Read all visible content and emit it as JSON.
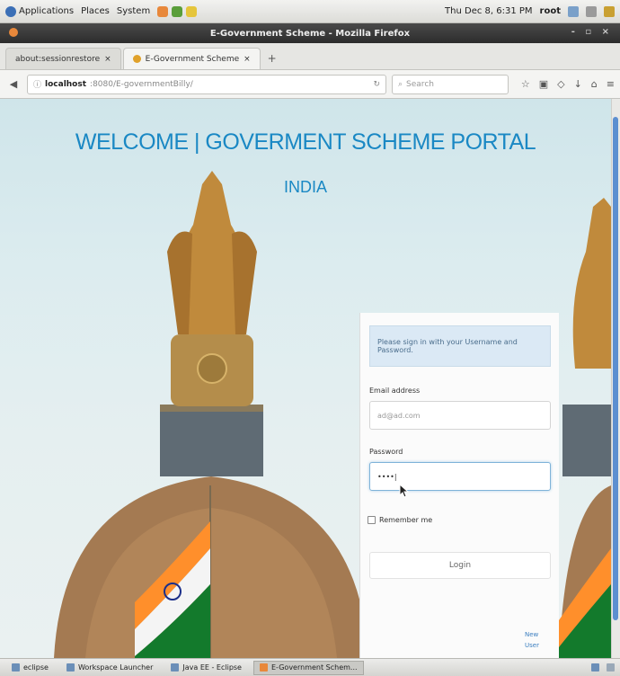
{
  "gnome_panel": {
    "menus": [
      "Applications",
      "Places",
      "System"
    ],
    "clock": "Thu Dec 8, 6:31 PM",
    "user": "root"
  },
  "window": {
    "title": "E-Government Scheme - Mozilla Firefox",
    "controls": "- ▫ ×"
  },
  "tabs": [
    {
      "label": "about:sessionrestore",
      "active": false
    },
    {
      "label": "E-Government Scheme",
      "active": true
    }
  ],
  "navbar": {
    "url_host": "localhost",
    "url_path": ":8080/E-governmentBilly/",
    "search_placeholder": "Search"
  },
  "page": {
    "heading": "WELCOME | GOVERMENT SCHEME PORTAL",
    "country": "INDIA",
    "login": {
      "info_text": "Please sign in with your Username and Password.",
      "email_label": "Email address",
      "email_placeholder": "ad@ad.com",
      "password_label": "Password",
      "password_value": "••••|",
      "remember_label": "Remember me",
      "login_button": "Login",
      "links": [
        "New",
        "User"
      ]
    }
  },
  "taskbar": {
    "items": [
      {
        "label": "eclipse",
        "active": false
      },
      {
        "label": "Workspace Launcher",
        "active": false
      },
      {
        "label": "Java EE - Eclipse",
        "active": false
      },
      {
        "label": "E-Government Schem...",
        "active": true
      }
    ]
  },
  "colors": {
    "heading": "#1a88c4",
    "info_bg": "#dbe9f5",
    "scroll_thumb": "#5c8fd0"
  }
}
